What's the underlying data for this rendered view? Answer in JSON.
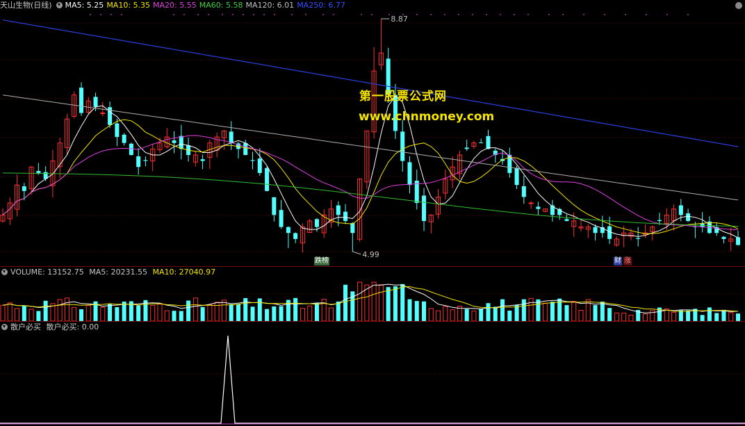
{
  "main": {
    "title": "天山生物(日线)",
    "ma_labels": [
      {
        "text": "MA5: 5.25",
        "color": "#ffffff"
      },
      {
        "text": "MA10: 5.35",
        "color": "#f5e600"
      },
      {
        "text": "MA20: 5.55",
        "color": "#e040e0"
      },
      {
        "text": "MA60: 5.58",
        "color": "#40d040"
      },
      {
        "text": "MA120: 6.01",
        "color": "#c0c0c0"
      },
      {
        "text": "MA250: 6.77",
        "color": "#3050ff"
      }
    ],
    "high_label": "8.87",
    "low_label": "4.99",
    "high_price": 8.87,
    "low_price": 4.99,
    "tags": [
      "跌榜",
      "财",
      "涨"
    ]
  },
  "volume": {
    "label": "VOLUME: 13152.75",
    "ma5": "MA5: 20231.55",
    "ma10": "MA10: 27040.97"
  },
  "indicator": {
    "title": "散户必买",
    "value": "散户必买: 0.00"
  },
  "watermark": {
    "line1": "第一股票公式网",
    "line2": "www.chnmoney.com"
  },
  "colors": {
    "up": "#ff3030",
    "down": "#54ffff",
    "ma5": "#ffffff",
    "ma10": "#f5e600",
    "ma20": "#e040e0",
    "ma60": "#30c030",
    "ma120": "#b0b0b0",
    "ma250": "#2a40e0"
  },
  "chart_data": {
    "type": "candlestick",
    "x_range": [
      0,
      150
    ],
    "closes": [
      5.6,
      5.8,
      6.1,
      6.0,
      6.4,
      6.3,
      6.2,
      6.5,
      6.8,
      7.2,
      7.6,
      7.3,
      7.5,
      7.4,
      7.3,
      7.1,
      6.9,
      6.8,
      6.6,
      6.4,
      6.5,
      6.7,
      6.8,
      6.9,
      6.8,
      6.7,
      6.6,
      6.6,
      6.5,
      6.8,
      6.9,
      7.0,
      6.8,
      6.7,
      6.6,
      6.5,
      6.3,
      6.0,
      5.6,
      5.4,
      5.3,
      5.2,
      5.4,
      5.5,
      5.4,
      5.6,
      5.7,
      5.6,
      5.5,
      5.3,
      6.2,
      7.0,
      8.0,
      8.3,
      7.6,
      7.0,
      6.5,
      6.1,
      5.8,
      5.5,
      5.6,
      5.9,
      6.2,
      6.4,
      6.6,
      6.7,
      6.8,
      6.8,
      6.7,
      6.6,
      6.5,
      6.3,
      6.1,
      5.9,
      5.8,
      5.7,
      5.7,
      5.6,
      5.6,
      5.5,
      5.5,
      5.4,
      5.4,
      5.3,
      5.3,
      5.2,
      5.2,
      5.3,
      5.3,
      5.2,
      5.3,
      5.4,
      5.5,
      5.6,
      5.7,
      5.6,
      5.5,
      5.4,
      5.4,
      5.3,
      5.3,
      5.2,
      5.2,
      5.1
    ],
    "candles_note": "",
    "volume_ma5": 20231.55,
    "volume_ma10": 27040.97
  }
}
